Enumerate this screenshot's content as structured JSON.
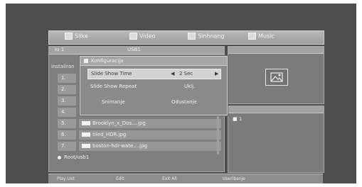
{
  "tabs": [
    {
      "label": "Slike",
      "icon": "image-icon"
    },
    {
      "label": "Video",
      "icon": "video-icon"
    },
    {
      "label": "Sinhnang",
      "icon": "music-note-icon"
    },
    {
      "label": "Music",
      "icon": "music-icon"
    }
  ],
  "device": {
    "name": "USB1",
    "prefix": "Iu 1"
  },
  "left_label": "instaliran",
  "dialog": {
    "title": "Konfiguracija",
    "option1_label": "Slide Show Time",
    "option1_value": "2 Sec",
    "option1_left_arrow": "◀",
    "option1_right_arrow": "▶",
    "option2_label": "Slide Show Repeat",
    "option2_value": "Uklj.",
    "save_button": "Snimanje",
    "cancel_button": "Odustanje"
  },
  "file_list": [
    {
      "num": "1.",
      "name": ""
    },
    {
      "num": "2.",
      "name": ""
    },
    {
      "num": "3.",
      "name": ""
    },
    {
      "num": "4.",
      "name": ""
    },
    {
      "num": "5.",
      "name": "Brooklyn_x_Dos....jpg"
    },
    {
      "num": "6.",
      "name": "tiled_HDR.jpg"
    },
    {
      "num": "7.",
      "name": "boston-hdr-wate....jpg"
    }
  ],
  "root_label": "Root/usb1",
  "info_text": "■ 1",
  "bottom_bar": [
    "Play List",
    "Edit",
    "Exit All",
    "Useribanje"
  ]
}
